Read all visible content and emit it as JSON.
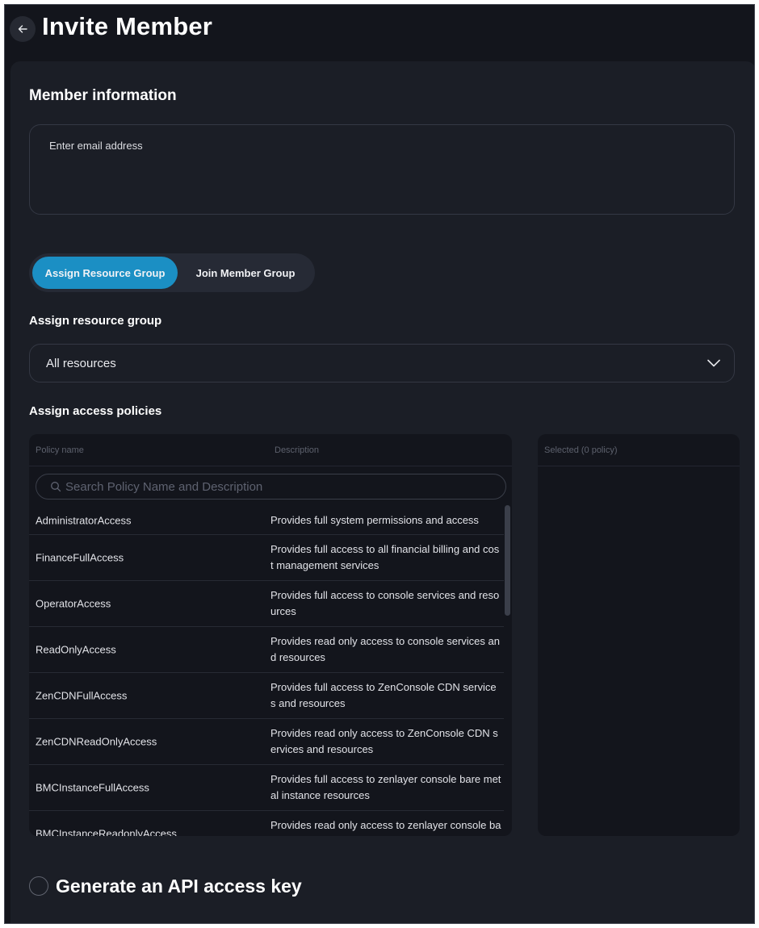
{
  "header": {
    "title": "Invite Member",
    "back_icon": "arrow-left-icon"
  },
  "member_info": {
    "title": "Member information",
    "email_placeholder": "Enter email address",
    "email_value": ""
  },
  "mode_toggle": {
    "options": [
      {
        "label": "Assign Resource Group",
        "active": true
      },
      {
        "label": "Join Member Group",
        "active": false
      }
    ],
    "active_color": "#1b8fc4"
  },
  "resource_group": {
    "title": "Assign resource group",
    "selected": "All resources"
  },
  "policies": {
    "title": "Assign access policies",
    "columns": {
      "name": "Policy name",
      "description": "Description"
    },
    "search_placeholder": "Search Policy Name and Description",
    "items": [
      {
        "name": "AdministratorAccess",
        "description": "Provides full system permissions and access"
      },
      {
        "name": "FinanceFullAccess",
        "description": "Provides full access to all financial billing and cost management services"
      },
      {
        "name": "OperatorAccess",
        "description": "Provides full access to console services and resources"
      },
      {
        "name": "ReadOnlyAccess",
        "description": "Provides read only access to console services and resources"
      },
      {
        "name": "ZenCDNFullAccess",
        "description": "Provides full access to ZenConsole CDN services and resources"
      },
      {
        "name": "ZenCDNReadOnlyAccess",
        "description": "Provides read only access to ZenConsole CDN services and resources"
      },
      {
        "name": "BMCInstanceFullAccess",
        "description": "Provides full access to zenlayer console bare metal instance resources"
      },
      {
        "name": "BMCInstanceReadonlyAccess",
        "description": "Provides read only access to zenlayer console bare metal instance resources"
      }
    ],
    "selected_header": "Selected (0 policy)"
  },
  "api_key": {
    "label": "Generate an API access key",
    "checked": false
  }
}
